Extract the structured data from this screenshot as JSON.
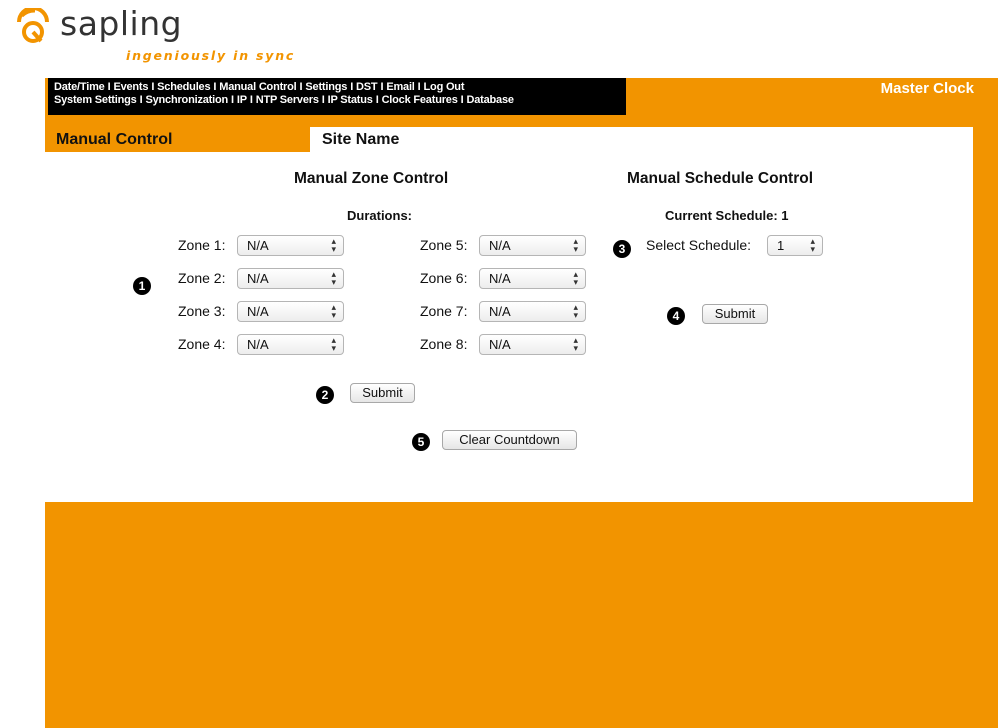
{
  "brand": {
    "name": "sapling",
    "tagline": "ingeniously in sync",
    "accent": "#f29400"
  },
  "nav": {
    "row1": [
      "Date/Time",
      "Events",
      "Schedules",
      "Manual Control",
      "Settings",
      "DST",
      "Email",
      "Log Out"
    ],
    "row2": [
      "System Settings",
      "Synchronization",
      "IP",
      "NTP Servers",
      "IP Status",
      "Clock Features",
      "Database"
    ],
    "separator": "I"
  },
  "header": {
    "device": "Master Clock",
    "page_title": "Manual Control",
    "site_name": "Site Name"
  },
  "zone_control": {
    "title": "Manual Zone Control",
    "durations_label": "Durations:",
    "zones": [
      {
        "label": "Zone 1:",
        "value": "N/A"
      },
      {
        "label": "Zone 2:",
        "value": "N/A"
      },
      {
        "label": "Zone 3:",
        "value": "N/A"
      },
      {
        "label": "Zone 4:",
        "value": "N/A"
      },
      {
        "label": "Zone 5:",
        "value": "N/A"
      },
      {
        "label": "Zone 6:",
        "value": "N/A"
      },
      {
        "label": "Zone 7:",
        "value": "N/A"
      },
      {
        "label": "Zone 8:",
        "value": "N/A"
      }
    ],
    "submit_label": "Submit",
    "clear_label": "Clear Countdown"
  },
  "schedule_control": {
    "title": "Manual Schedule Control",
    "current": "Current Schedule: 1",
    "select_label": "Select Schedule:",
    "select_value": "1",
    "submit_label": "Submit"
  },
  "callouts": [
    "1",
    "2",
    "3",
    "4",
    "5"
  ]
}
